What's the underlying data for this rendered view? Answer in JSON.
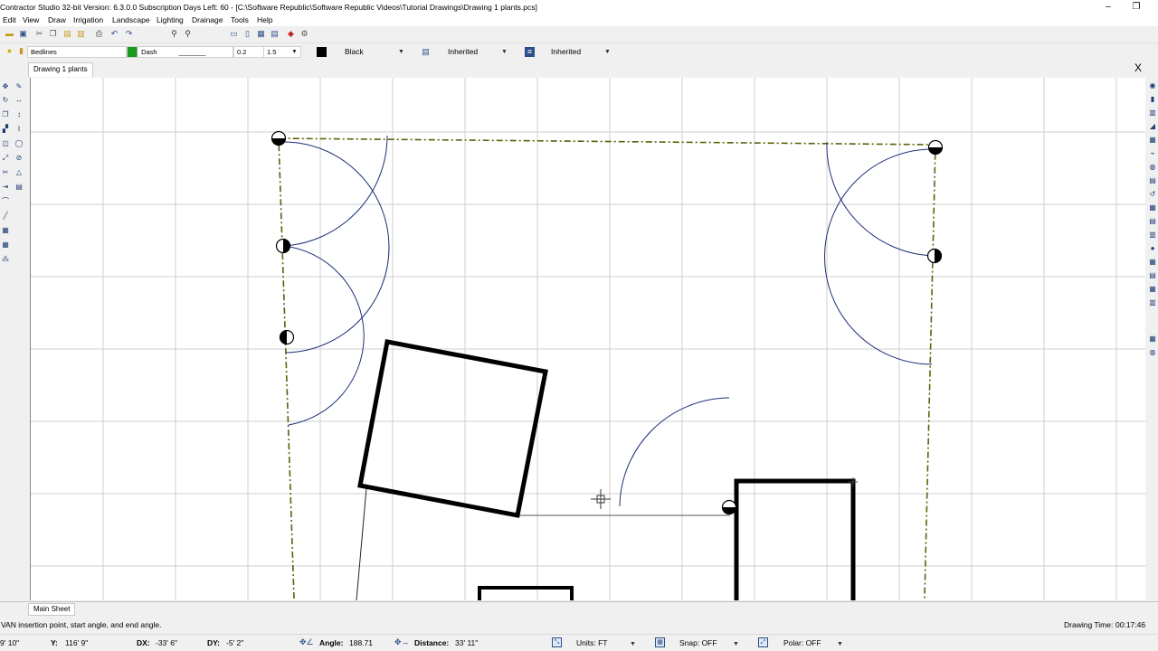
{
  "window": {
    "title": "Contractor Studio 32-bit   Version: 6.3.0.0   Subscription Days Left: 60 - [C:\\Software Republic\\Software Republic Videos\\Tutorial Drawings\\Drawing 1 plants.pcs]",
    "minimize": "–",
    "maximize": "❐"
  },
  "menu": [
    "Edit",
    "View",
    "Draw",
    "Irrigation",
    "Landscape",
    "Lighting",
    "Drainage",
    "Tools",
    "Help"
  ],
  "properties_bar": {
    "layer": "Bedlines",
    "linetype_name": "Dash",
    "linetype_sample": "_ _ _ _ _ _ _",
    "line_width": "0.2",
    "scale": "1.5",
    "color_name": "Black",
    "color_hex": "#000000",
    "layer_color_hex": "#1a9a1a",
    "style1": "Inherited",
    "style2": "Inherited"
  },
  "tabs": {
    "document": "Drawing 1 plants",
    "close": "X"
  },
  "sheet": {
    "tab": "Main Sheet"
  },
  "status": {
    "prompt": "VAN insertion point, start angle, and end angle.",
    "drawing_time_label": "Drawing Time:",
    "drawing_time": "00:17:46"
  },
  "coords": {
    "x_val": "9' 10\"",
    "y_label": "Y:",
    "y_val": "116' 9\"",
    "dx_label": "DX:",
    "dx_val": "-33' 6\"",
    "dy_label": "DY:",
    "dy_val": "-5' 2\"",
    "angle_label": "Angle:",
    "angle_val": "188.71",
    "distance_label": "Distance:",
    "distance_val": "33' 11\"",
    "units": "Units: FT",
    "snap": "Snap: OFF",
    "polar": "Polar: OFF"
  },
  "colors": {
    "property_line": "#5f5f0a",
    "arcs": "#1c2f7a",
    "grid": "#cfcfcf",
    "walls": "#000000"
  }
}
